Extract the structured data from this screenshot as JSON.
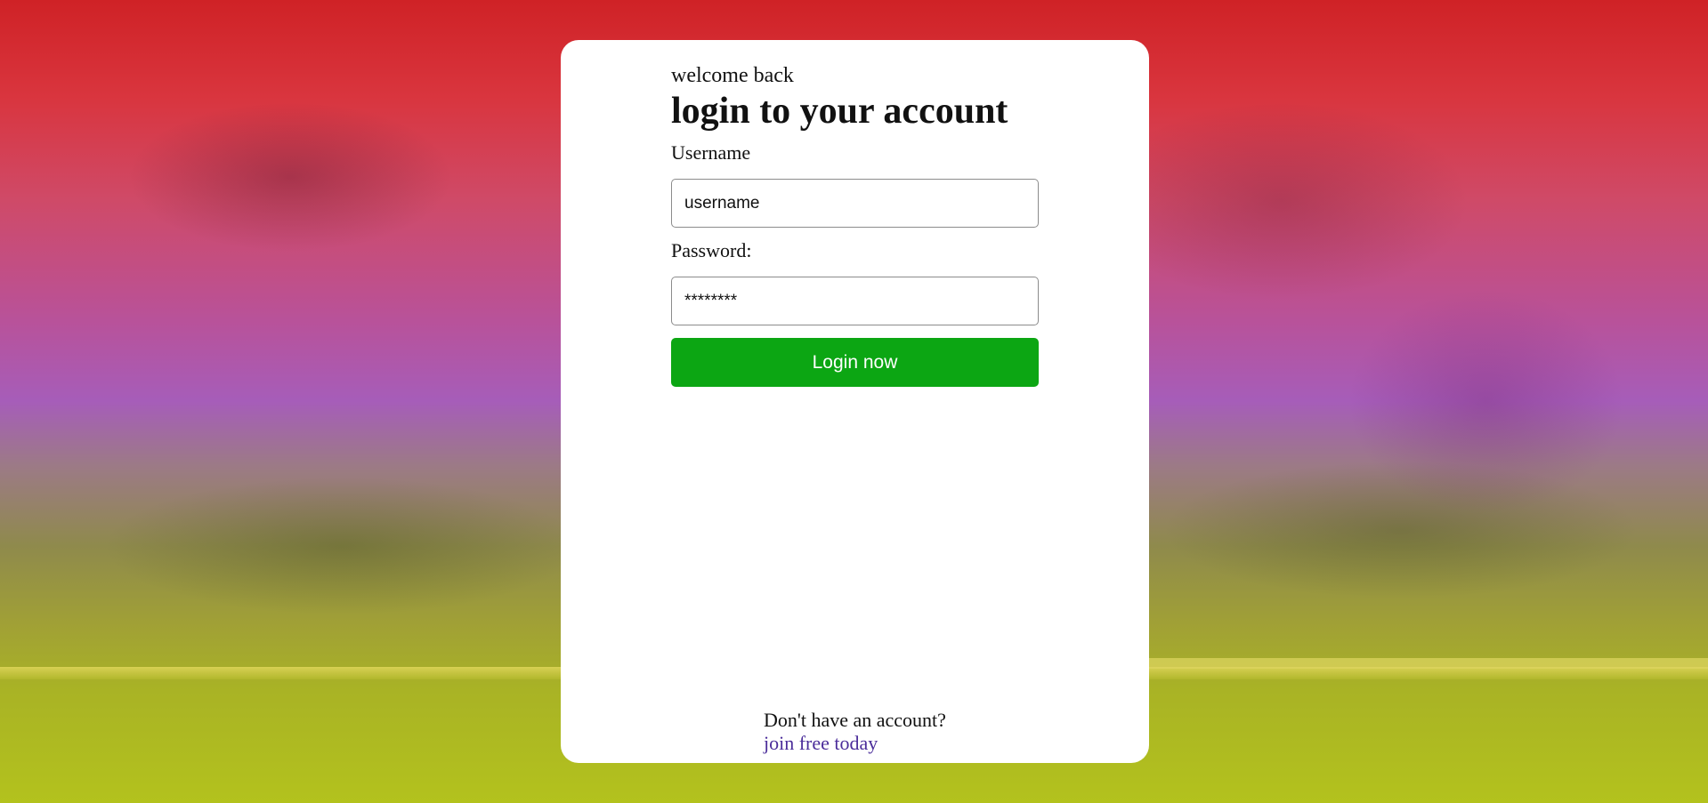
{
  "login": {
    "welcome_text": "welcome back",
    "heading": "login to your account",
    "username": {
      "label": "Username",
      "value": "username"
    },
    "password": {
      "label": "Password:",
      "value": "********"
    },
    "submit_label": "Login now",
    "signup": {
      "prompt": "Don't have an account?",
      "link_text": "join free today"
    }
  },
  "colors": {
    "button_bg": "#0ca613",
    "link": "#4b2d9a",
    "card_bg": "#ffffff"
  }
}
